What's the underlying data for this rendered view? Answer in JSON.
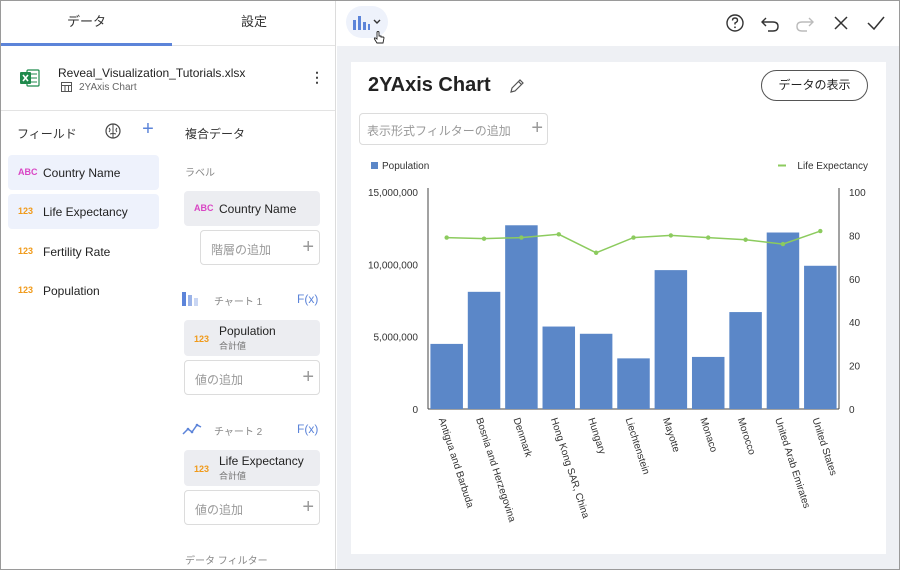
{
  "tabs": {
    "data": "データ",
    "settings": "設定"
  },
  "file": {
    "name": "Reveal_Visualization_Tutorials.xlsx",
    "sheet": "2YAxis Chart"
  },
  "fields": {
    "header": "フィールド",
    "items": [
      {
        "type": "ABC",
        "label": "Country Name"
      },
      {
        "type": "123",
        "label": "Life Expectancy"
      },
      {
        "type": "123",
        "label": "Fertility Rate"
      },
      {
        "type": "123",
        "label": "Population"
      }
    ]
  },
  "combo": {
    "header": "複合データ",
    "label_section": "ラベル",
    "label_pill": {
      "type": "ABC",
      "label": "Country Name"
    },
    "add_hierarchy": "階層の追加",
    "chart1": {
      "label": "チャート 1",
      "fx": "F(x)",
      "pill": {
        "type": "123",
        "label": "Population",
        "sub": "合計値"
      },
      "add_value": "値の追加"
    },
    "chart2": {
      "label": "チャート 2",
      "fx": "F(x)",
      "pill": {
        "type": "123",
        "label": "Life Expectancy",
        "sub": "合計値"
      },
      "add_value": "値の追加"
    },
    "data_filter": "データ フィルター"
  },
  "card": {
    "title": "2YAxis Chart",
    "show_data": "データの表示",
    "filter_placeholder": "表示形式フィルターの追加"
  },
  "colors": {
    "bar": "#5b87c8",
    "line": "#8ccb5e",
    "accent": "#5c84d9"
  },
  "chart_data": {
    "type": "bar",
    "categories": [
      "Antigua and Barbuda",
      "Bosnia and Herzegovina",
      "Denmark",
      "Hong Kong SAR, China",
      "Hungary",
      "Liechtenstein",
      "Mayotte",
      "Monaco",
      "Morocco",
      "United Arab Emirates",
      "United States"
    ],
    "series": [
      {
        "name": "Population",
        "axis": "left",
        "type": "bar",
        "values": [
          4500000,
          8100000,
          12700000,
          5700000,
          5200000,
          3500000,
          9600000,
          3600000,
          6700000,
          12200000,
          9900000
        ]
      },
      {
        "name": "Life Expectancy",
        "axis": "right",
        "type": "line",
        "values": [
          79,
          78.5,
          79,
          80.5,
          72,
          79,
          80,
          79,
          78,
          76,
          82
        ]
      }
    ],
    "left_axis": {
      "ticks": [
        "0",
        "5,000,000",
        "10,000,000",
        "15,000,000"
      ],
      "ylim": [
        0,
        15000000
      ]
    },
    "right_axis": {
      "ticks": [
        "0",
        "20",
        "40",
        "60",
        "80",
        "100"
      ],
      "ylim": [
        0,
        100
      ]
    },
    "legend": {
      "placement": "top",
      "left": "Population",
      "right": "Life Expectancy"
    },
    "grid": false
  }
}
